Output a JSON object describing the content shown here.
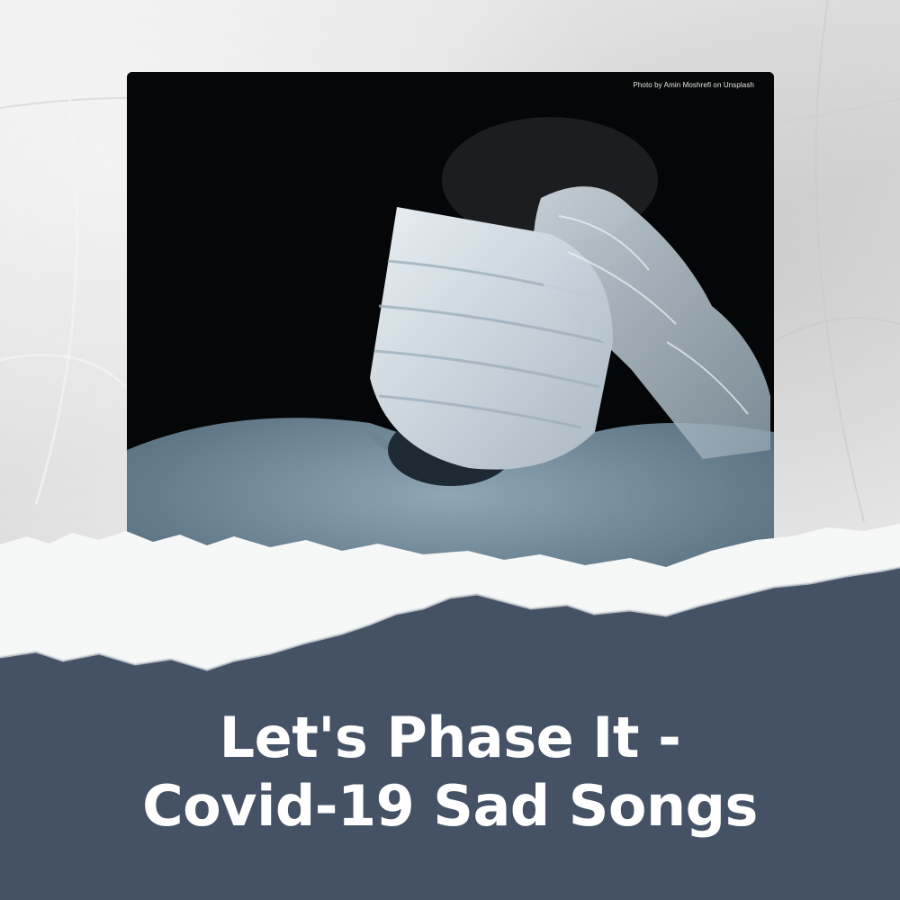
{
  "photo": {
    "credit": "Photo by Amin Moshrefi on Unsplash"
  },
  "title": {
    "line1": "Let's Phase It -",
    "line2": "Covid-19 Sad Songs"
  },
  "colors": {
    "paper": "#e6e6e6",
    "banner": "#455265",
    "title_text": "#ffffff",
    "photo_bg": "#050607"
  }
}
